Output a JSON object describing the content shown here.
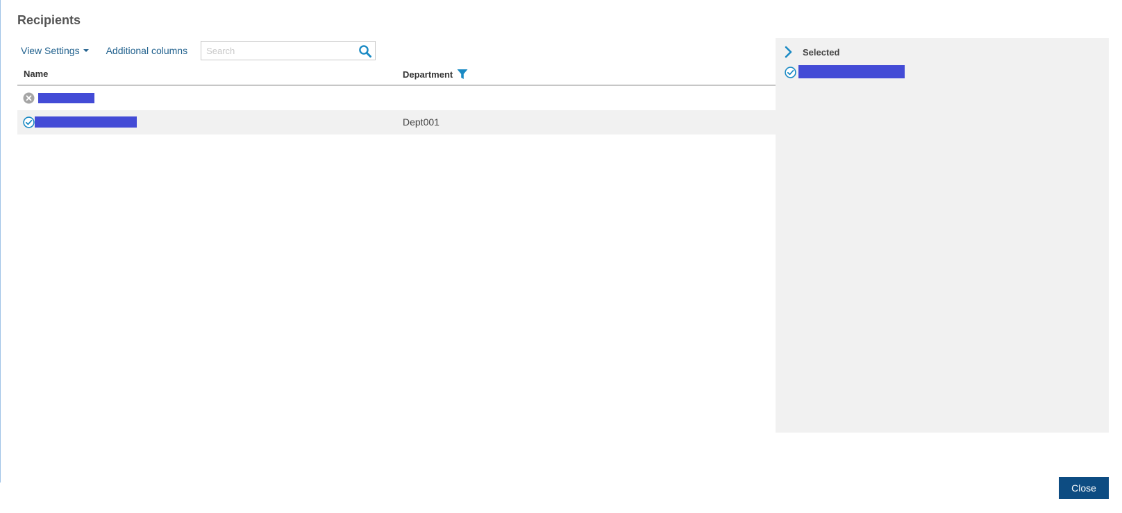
{
  "dialog": {
    "title": "Recipients",
    "close_label": "Close"
  },
  "toolbar": {
    "view_settings_label": "View Settings",
    "additional_columns_label": "Additional columns",
    "search_placeholder": "Search",
    "search_value": ""
  },
  "grid": {
    "columns": [
      "Name",
      "Department"
    ],
    "rows": [
      {
        "status": "remove-icon",
        "name": "[redacted]",
        "department": ""
      },
      {
        "status": "selected-check-icon",
        "name": "[redacted]",
        "department": "Dept001"
      }
    ]
  },
  "selected_panel": {
    "title": "Selected",
    "items": [
      {
        "status": "selected-check-icon",
        "name": "[redacted]"
      }
    ]
  },
  "colors": {
    "accent": "#1a8ac4",
    "link": "#1e5f8c",
    "button": "#0d4c82",
    "redaction": "#434bd6",
    "panel_bg": "#f1f1f1"
  }
}
